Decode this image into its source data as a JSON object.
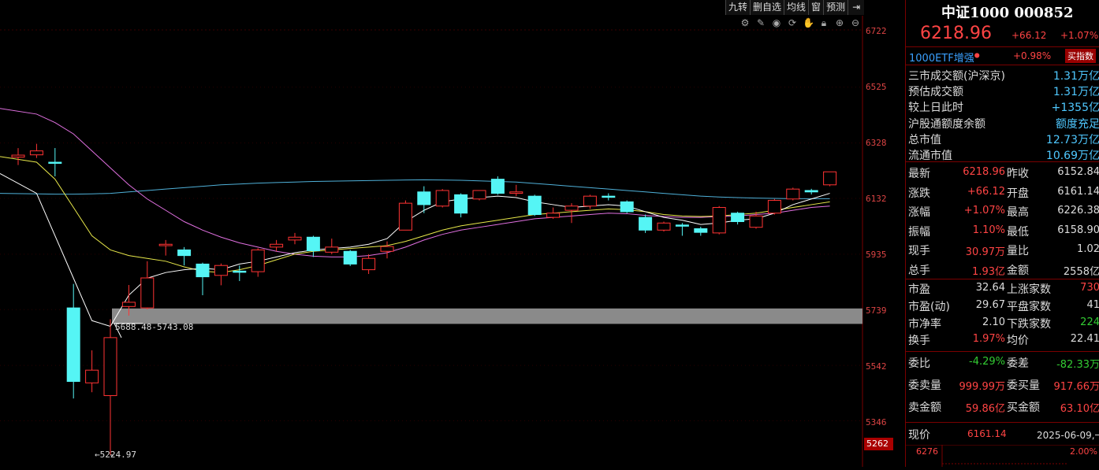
{
  "toolbar": {
    "items": [
      "九转",
      "删自选",
      "均线",
      "窗",
      "预测"
    ],
    "exit_icon": "exit-icon"
  },
  "tools": [
    "gear-icon",
    "pen-icon",
    "eye-icon",
    "cycle-icon",
    "hand-icon",
    "lock-icon",
    "zoom-in-icon",
    "zoom-out-icon"
  ],
  "y_axis": {
    "ticks": [
      "6722",
      "6525",
      "6328",
      "6132",
      "5935",
      "5739",
      "5542",
      "5346"
    ],
    "current_tag": "5262"
  },
  "annotations": {
    "range": "5688.48-5743.08",
    "low": "5224.97"
  },
  "colors": {
    "up": "#ff3333",
    "down": "#55f5f5",
    "ma_white": "#ffffff",
    "ma_yellow": "#e8e84a",
    "ma_pink": "#e070e0",
    "ma_blue": "#4fb0d8",
    "band": "#8a8a8a"
  },
  "chart_data": {
    "type": "candlestick",
    "candles": [
      {
        "o": 6285,
        "c": 6278,
        "h": 6310,
        "l": 6250,
        "up": true
      },
      {
        "o": 6286,
        "c": 6300,
        "h": 6325,
        "l": 6275,
        "up": true
      },
      {
        "o": 6260,
        "c": 6258,
        "h": 6310,
        "l": 6210,
        "up": false
      },
      {
        "o": 5745,
        "c": 5485,
        "h": 5830,
        "l": 5425,
        "up": false
      },
      {
        "o": 5480,
        "c": 5525,
        "h": 5595,
        "l": 5447,
        "up": true
      },
      {
        "o": 5435,
        "c": 5640,
        "h": 5705,
        "l": 5225,
        "up": true
      },
      {
        "o": 5750,
        "c": 5765,
        "h": 5826,
        "l": 5718,
        "up": true
      },
      {
        "o": 5745,
        "c": 5851,
        "h": 5910,
        "l": 5740,
        "up": true
      },
      {
        "o": 5965,
        "c": 5970,
        "h": 5985,
        "l": 5930,
        "up": true
      },
      {
        "o": 5950,
        "c": 5930,
        "h": 5960,
        "l": 5895,
        "up": false
      },
      {
        "o": 5900,
        "c": 5855,
        "h": 5905,
        "l": 5790,
        "up": false
      },
      {
        "o": 5860,
        "c": 5895,
        "h": 5902,
        "l": 5825,
        "up": true
      },
      {
        "o": 5875,
        "c": 5875,
        "h": 5895,
        "l": 5840,
        "up": false
      },
      {
        "o": 5873,
        "c": 5950,
        "h": 5956,
        "l": 5855,
        "up": true
      },
      {
        "o": 5960,
        "c": 5970,
        "h": 5985,
        "l": 5945,
        "up": true
      },
      {
        "o": 5985,
        "c": 5995,
        "h": 6010,
        "l": 5970,
        "up": true
      },
      {
        "o": 5995,
        "c": 5947,
        "h": 6000,
        "l": 5925,
        "up": false
      },
      {
        "o": 5960,
        "c": 5942,
        "h": 5990,
        "l": 5935,
        "up": true
      },
      {
        "o": 5945,
        "c": 5900,
        "h": 5950,
        "l": 5893,
        "up": false
      },
      {
        "o": 5880,
        "c": 5920,
        "h": 5935,
        "l": 5865,
        "up": true
      },
      {
        "o": 5945,
        "c": 5962,
        "h": 5980,
        "l": 5920,
        "up": true
      },
      {
        "o": 6020,
        "c": 6115,
        "h": 6125,
        "l": 6020,
        "up": true
      },
      {
        "o": 6155,
        "c": 6110,
        "h": 6175,
        "l": 6080,
        "up": false
      },
      {
        "o": 6160,
        "c": 6105,
        "h": 6165,
        "l": 6100,
        "up": true
      },
      {
        "o": 6145,
        "c": 6080,
        "h": 6150,
        "l": 6065,
        "up": false
      },
      {
        "o": 6130,
        "c": 6160,
        "h": 6160,
        "l": 6125,
        "up": true
      },
      {
        "o": 6200,
        "c": 6150,
        "h": 6210,
        "l": 6145,
        "up": false
      },
      {
        "o": 6150,
        "c": 6155,
        "h": 6180,
        "l": 6140,
        "up": true
      },
      {
        "o": 6140,
        "c": 6075,
        "h": 6145,
        "l": 6070,
        "up": false
      },
      {
        "o": 6065,
        "c": 6080,
        "h": 6100,
        "l": 6060,
        "up": true
      },
      {
        "o": 6090,
        "c": 6105,
        "h": 6115,
        "l": 6045,
        "up": true
      },
      {
        "o": 6105,
        "c": 6140,
        "h": 6145,
        "l": 6095,
        "up": true
      },
      {
        "o": 6140,
        "c": 6140,
        "h": 6150,
        "l": 6125,
        "up": false
      },
      {
        "o": 6120,
        "c": 6085,
        "h": 6125,
        "l": 6080,
        "up": false
      },
      {
        "o": 6065,
        "c": 6020,
        "h": 6075,
        "l": 6010,
        "up": false
      },
      {
        "o": 6020,
        "c": 6045,
        "h": 6050,
        "l": 6015,
        "up": true
      },
      {
        "o": 6038,
        "c": 6035,
        "h": 6045,
        "l": 6000,
        "up": false
      },
      {
        "o": 6025,
        "c": 6012,
        "h": 6032,
        "l": 6000,
        "up": false
      },
      {
        "o": 6010,
        "c": 6100,
        "h": 6105,
        "l": 6005,
        "up": true
      },
      {
        "o": 6080,
        "c": 6050,
        "h": 6085,
        "l": 6040,
        "up": false
      },
      {
        "o": 6030,
        "c": 6070,
        "h": 6085,
        "l": 6025,
        "up": true
      },
      {
        "o": 6080,
        "c": 6125,
        "h": 6130,
        "l": 6075,
        "up": true
      },
      {
        "o": 6130,
        "c": 6165,
        "h": 6170,
        "l": 6125,
        "up": true
      },
      {
        "o": 6160,
        "c": 6155,
        "h": 6166,
        "l": 6146,
        "up": false
      },
      {
        "o": 6180,
        "c": 6226,
        "h": 6226,
        "l": 6175,
        "up": true
      }
    ],
    "ma_white": [
      6220,
      6150,
      6000,
      5850,
      5700,
      5680,
      5790,
      5850,
      5870,
      5880,
      5885,
      5880,
      5900,
      5910,
      5925,
      5940,
      5950,
      5955,
      5960,
      5970,
      5990,
      6050,
      6090,
      6120,
      6130,
      6135,
      6140,
      6135,
      6120,
      6110,
      6100,
      6105,
      6110,
      6105,
      6085,
      6065,
      6055,
      6040,
      6045,
      6055,
      6060,
      6080,
      6110,
      6130,
      6150
    ],
    "ma_yellow": [
      6280,
      6260,
      6200,
      6100,
      6000,
      5950,
      5930,
      5920,
      5910,
      5890,
      5875,
      5870,
      5880,
      5895,
      5915,
      5935,
      5945,
      5950,
      5955,
      5960,
      5965,
      5980,
      6000,
      6020,
      6035,
      6045,
      6055,
      6065,
      6075,
      6080,
      6085,
      6090,
      6095,
      6092,
      6085,
      6075,
      6070,
      6068,
      6070,
      6075,
      6080,
      6090,
      6100,
      6110,
      6120
    ],
    "ma_pink": [
      6450,
      6430,
      6400,
      6360,
      6300,
      6240,
      6180,
      6130,
      6090,
      6050,
      6020,
      5995,
      5975,
      5960,
      5945,
      5935,
      5928,
      5925,
      5925,
      5930,
      5940,
      5960,
      5985,
      6005,
      6020,
      6030,
      6040,
      6050,
      6060,
      6065,
      6070,
      6075,
      6080,
      6078,
      6072,
      6068,
      6065,
      6065,
      6068,
      6070,
      6075,
      6080,
      6090,
      6100,
      6105
    ],
    "ma_blue": [
      6150,
      6148,
      6147,
      6147,
      6148,
      6150,
      6155,
      6160,
      6165,
      6170,
      6175,
      6180,
      6183,
      6186,
      6188,
      6190,
      6192,
      6193,
      6194,
      6195,
      6196,
      6197,
      6198,
      6197,
      6196,
      6194,
      6192,
      6190,
      6185,
      6180,
      6175,
      6170,
      6165,
      6160,
      6155,
      6150,
      6145,
      6140,
      6137,
      6135,
      6133,
      6132,
      6131,
      6131,
      6131
    ],
    "band": [
      5688.48,
      5743.08
    ],
    "ylim": [
      5224.97,
      6722
    ]
  },
  "panel": {
    "title": "中证1000 000852",
    "price": "6218.96",
    "change": "+66.12",
    "change_pct": "+1.07%",
    "etf_name": "1000ETF增强",
    "etf_dot": "●",
    "etf_pct": "+0.98%",
    "etf_button": "买指数",
    "stats": [
      {
        "label": "三市成交额(沪深京)",
        "value": "1.31万亿"
      },
      {
        "label": "预估成交额",
        "value": "1.31万亿"
      },
      {
        "label": "较上日此时",
        "value": "+1355亿"
      },
      {
        "label": "沪股通额度余额",
        "value": "额度充足"
      },
      {
        "label": "总市值",
        "value": "12.73万亿"
      },
      {
        "label": "流通市值",
        "value": "10.69万亿"
      }
    ],
    "quotes": [
      {
        "l1": "最新",
        "v1": "6218.96",
        "l2": "昨收",
        "v2": "6152.84"
      },
      {
        "l1": "涨跌",
        "v1": "+66.12",
        "l2": "开盘",
        "v2": "6161.14"
      },
      {
        "l1": "涨幅",
        "v1": "+1.07%",
        "l2": "最高",
        "v2": "6226.38"
      },
      {
        "l1": "振幅",
        "v1": "1.10%",
        "l2": "最低",
        "v2": "6158.90"
      },
      {
        "l1": "现手",
        "v1": "30.97万",
        "l2": "量比",
        "v2": "1.02"
      },
      {
        "l1": "总手",
        "v1": "1.93亿",
        "l2": "金额",
        "v2": "2558亿"
      }
    ],
    "valuation": [
      {
        "l1": "市盈",
        "v1": "32.64",
        "l2": "上涨家数",
        "v2": "730"
      },
      {
        "l1": "市盈(动)",
        "v1": "29.67",
        "l2": "平盘家数",
        "v2": "41"
      },
      {
        "l1": "市净率",
        "v1": "2.10",
        "l2": "下跌家数",
        "v2": "224"
      },
      {
        "l1": "换手",
        "v1": "1.97%",
        "l2": "均价",
        "v2": "22.41"
      }
    ],
    "order": [
      {
        "l1": "委比",
        "v1": "-4.29%",
        "l2": "委差",
        "v2": "-82.33万"
      },
      {
        "l1": "委卖量",
        "v1": "999.99万",
        "l2": "委买量",
        "v2": "917.66万"
      },
      {
        "l1": "卖金额",
        "v1": "59.86亿",
        "l2": "买金额",
        "v2": "63.10亿"
      }
    ],
    "now_label": "现价",
    "now_price": "6161.14",
    "now_date": "2025-06-09,一",
    "mini_top": "6276",
    "mini_pct": "2.00%"
  }
}
